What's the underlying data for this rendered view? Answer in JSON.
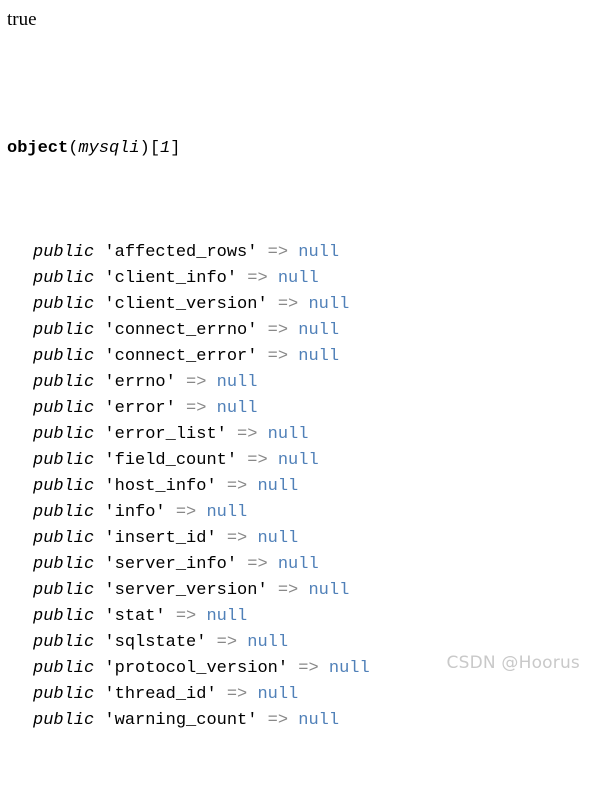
{
  "page": {
    "background_color": "#ffffff",
    "text_color": "#000000"
  },
  "output": {
    "boolean_dump": "true",
    "object_header": {
      "keyword": "object",
      "open_paren": "(",
      "class_name": "mysqli",
      "close_paren": ")",
      "open_bracket": "[",
      "object_id": "1",
      "close_bracket": "]"
    },
    "visibility_label": "public",
    "arrow": "=>",
    "null_label": "null",
    "quote": "'",
    "properties": [
      {
        "visibility": "public",
        "name": "affected_rows",
        "arrow": "=>",
        "value": "null"
      },
      {
        "visibility": "public",
        "name": "client_info",
        "arrow": "=>",
        "value": "null"
      },
      {
        "visibility": "public",
        "name": "client_version",
        "arrow": "=>",
        "value": "null"
      },
      {
        "visibility": "public",
        "name": "connect_errno",
        "arrow": "=>",
        "value": "null"
      },
      {
        "visibility": "public",
        "name": "connect_error",
        "arrow": "=>",
        "value": "null"
      },
      {
        "visibility": "public",
        "name": "errno",
        "arrow": "=>",
        "value": "null"
      },
      {
        "visibility": "public",
        "name": "error",
        "arrow": "=>",
        "value": "null"
      },
      {
        "visibility": "public",
        "name": "error_list",
        "arrow": "=>",
        "value": "null"
      },
      {
        "visibility": "public",
        "name": "field_count",
        "arrow": "=>",
        "value": "null"
      },
      {
        "visibility": "public",
        "name": "host_info",
        "arrow": "=>",
        "value": "null"
      },
      {
        "visibility": "public",
        "name": "info",
        "arrow": "=>",
        "value": "null"
      },
      {
        "visibility": "public",
        "name": "insert_id",
        "arrow": "=>",
        "value": "null"
      },
      {
        "visibility": "public",
        "name": "server_info",
        "arrow": "=>",
        "value": "null"
      },
      {
        "visibility": "public",
        "name": "server_version",
        "arrow": "=>",
        "value": "null"
      },
      {
        "visibility": "public",
        "name": "stat",
        "arrow": "=>",
        "value": "null"
      },
      {
        "visibility": "public",
        "name": "sqlstate",
        "arrow": "=>",
        "value": "null"
      },
      {
        "visibility": "public",
        "name": "protocol_version",
        "arrow": "=>",
        "value": "null"
      },
      {
        "visibility": "public",
        "name": "thread_id",
        "arrow": "=>",
        "value": "null"
      },
      {
        "visibility": "public",
        "name": "warning_count",
        "arrow": "=>",
        "value": "null"
      }
    ]
  },
  "watermark": {
    "text": "CSDN @Hoorus",
    "color": "#c9c9c9"
  },
  "colors": {
    "null_value": "#5080b8",
    "arrow": "#888888",
    "text": "#000000",
    "watermark": "#c9c9c9"
  }
}
